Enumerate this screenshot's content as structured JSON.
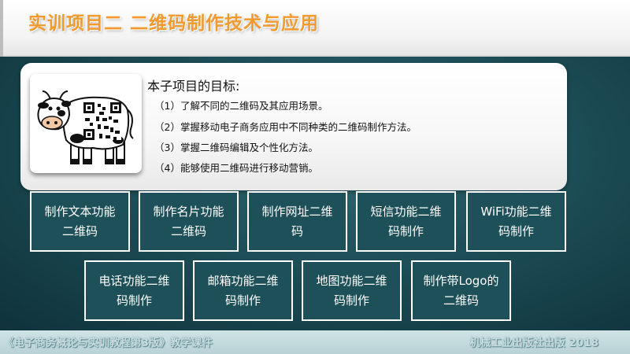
{
  "slide": {
    "title": "实训项目二  二维码制作技术与应用",
    "goals": {
      "heading": "本子项目的目标:",
      "items": [
        "（1）了解不同的二维码及其应用场景。",
        "（2）掌握移动电子商务应用中不同种类的二维码制作方法。",
        "（3）掌握二维码编辑及个性化方法。",
        "（4）能够使用二维码进行移动营销。"
      ]
    },
    "functions_row1": [
      {
        "line1": "制作文本功能",
        "line2": "二维码"
      },
      {
        "line1": "制作名片功能",
        "line2": "二维码"
      },
      {
        "line1": "制作网址二维",
        "line2": "码"
      },
      {
        "line1": "短信功能二维",
        "line2": "码制作"
      },
      {
        "line1": "WiFi功能二维",
        "line2": "码制作"
      }
    ],
    "functions_row2": [
      {
        "line1": "电话功能二维",
        "line2": "码制作"
      },
      {
        "line1": "邮箱功能二维",
        "line2": "码制作"
      },
      {
        "line1": "地图功能二维",
        "line2": "码制作"
      },
      {
        "line1": "制作带Logo的",
        "line2": "二维码"
      }
    ]
  },
  "footer": {
    "left": "《电子商务概论与实训教程第3版》教学课件",
    "right": "机械工业出版社出版  2018"
  },
  "colors": {
    "title": "#f29a2e",
    "background": "#1c4b54",
    "box_fill": "#1d5058",
    "box_border": "#ffffff"
  },
  "icons": {
    "illustration": "cow-qr-code-image"
  }
}
